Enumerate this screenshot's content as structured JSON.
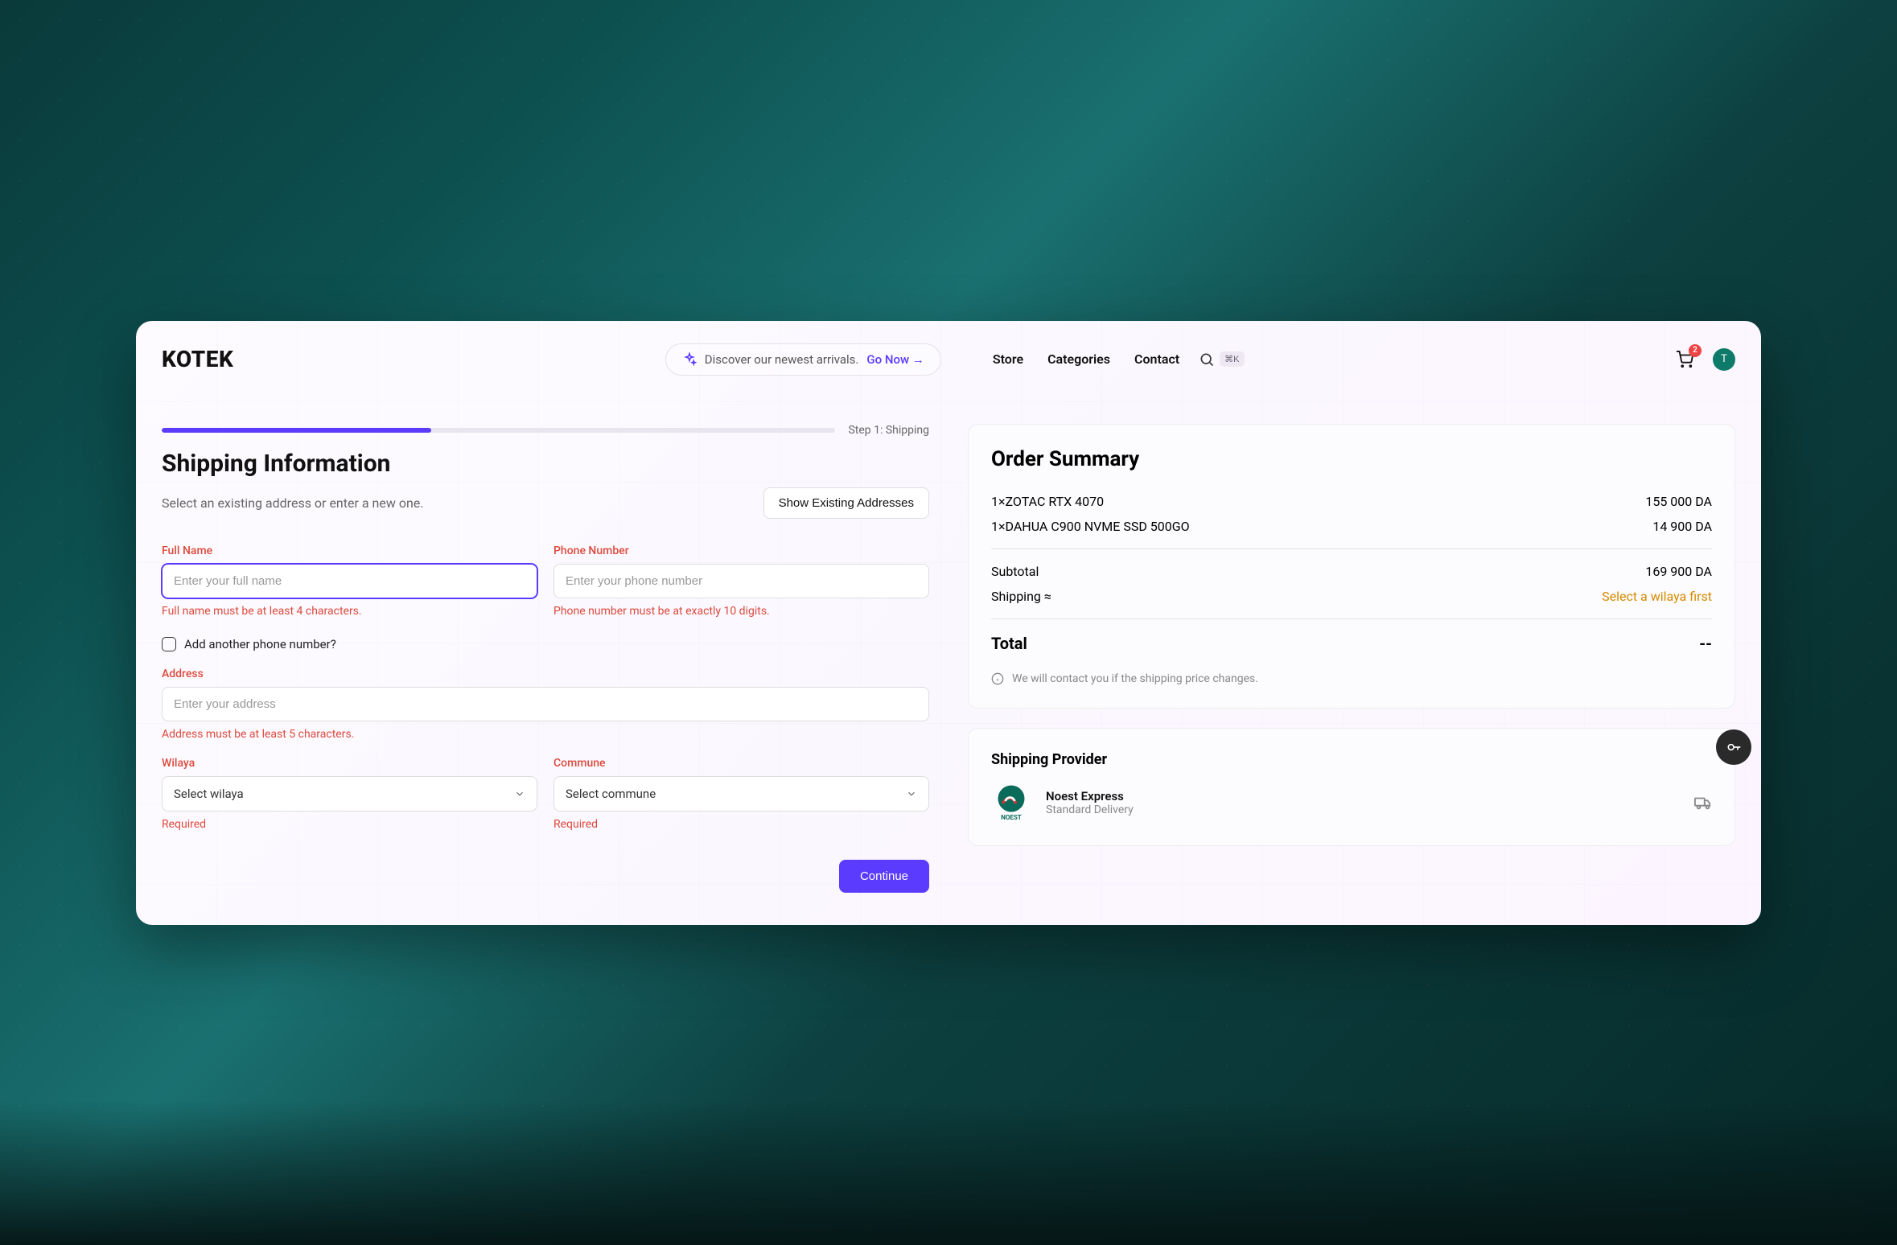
{
  "header": {
    "logo": "KOTEK",
    "promo_text": "Discover our newest arrivals.",
    "promo_cta": "Go Now →",
    "nav": {
      "store": "Store",
      "categories": "Categories",
      "contact": "Contact"
    },
    "search_shortcut": "⌘K",
    "cart_count": "2",
    "avatar_initial": "T"
  },
  "step": {
    "label": "Step 1: Shipping"
  },
  "shipping": {
    "title": "Shipping Information",
    "subtitle": "Select an existing address or enter a new one.",
    "show_existing_btn": "Show Existing Addresses",
    "full_name_label": "Full Name",
    "full_name_placeholder": "Enter your full name",
    "full_name_error": "Full name must be at least 4 characters.",
    "phone_label": "Phone Number",
    "phone_placeholder": "Enter your phone number",
    "phone_error": "Phone number must be at exactly 10 digits.",
    "add_phone_label": "Add another phone number?",
    "address_label": "Address",
    "address_placeholder": "Enter your address",
    "address_error": "Address must be at least 5 characters.",
    "wilaya_label": "Wilaya",
    "wilaya_placeholder": "Select wilaya",
    "wilaya_error": "Required",
    "commune_label": "Commune",
    "commune_placeholder": "Select commune",
    "commune_error": "Required",
    "continue_btn": "Continue"
  },
  "summary": {
    "title": "Order Summary",
    "items": [
      {
        "label": "1×ZOTAC RTX 4070",
        "price": "155 000 DA"
      },
      {
        "label": "1×DAHUA C900 NVME SSD 500GO",
        "price": "14 900 DA"
      }
    ],
    "subtotal_label": "Subtotal",
    "subtotal_value": "169 900 DA",
    "shipping_label": "Shipping ≈",
    "shipping_value": "Select a wilaya first",
    "total_label": "Total",
    "total_value": "--",
    "info_text": "We will contact you if the shipping price changes."
  },
  "provider": {
    "title": "Shipping Provider",
    "name": "Noest Express",
    "sub": "Standard Delivery",
    "logo_text": "NOEST"
  }
}
